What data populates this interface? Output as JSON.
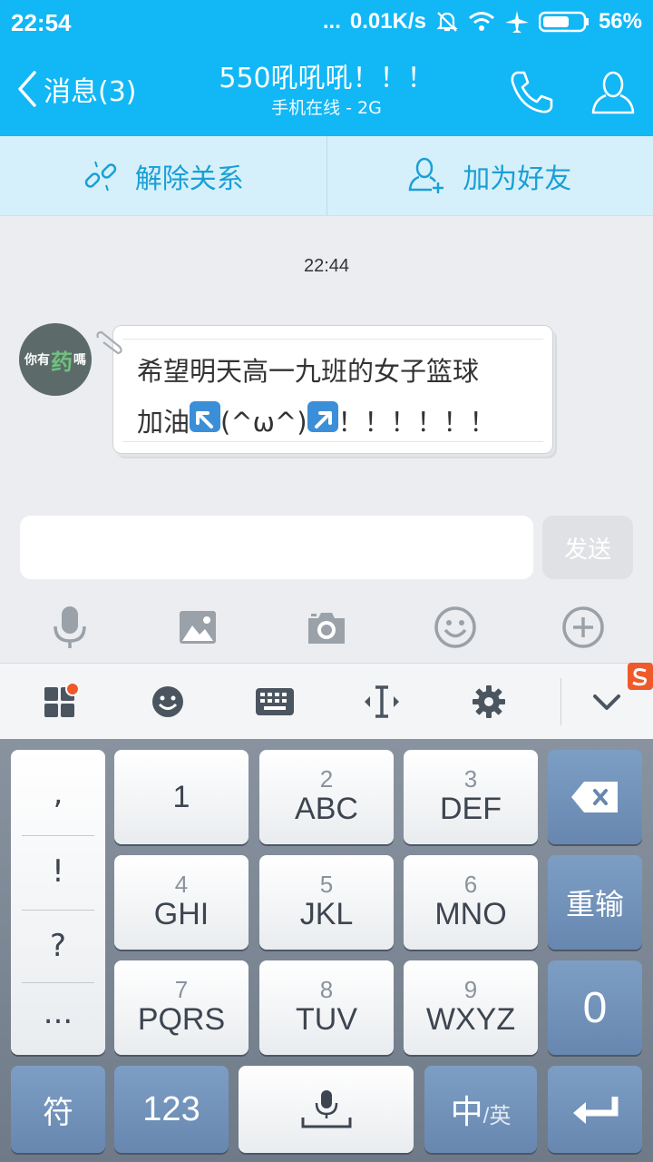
{
  "status_bar": {
    "time": "22:54",
    "dots": "...",
    "speed": "0.01K/s",
    "battery": "56%"
  },
  "header": {
    "back_label": "消息(3)",
    "title": "550吼吼吼！！！",
    "subtitle": "手机在线 - 2G"
  },
  "actions": {
    "unlink_label": "解除关系",
    "add_friend_label": "加为好友"
  },
  "chat": {
    "timestamp": "22:44",
    "avatar_text_1": "你有",
    "avatar_text_2": "药",
    "avatar_text_3": "嗎",
    "message_line1": "希望明天高一九班的女子篮球",
    "message_line2_a": "加油",
    "message_line2_b": "(^ω^)",
    "message_line2_c": "！！！！！！"
  },
  "composer": {
    "input_value": "",
    "send_label": "发送"
  },
  "keyboard": {
    "punct": [
      ",",
      "!",
      "?",
      "..."
    ],
    "row1": [
      {
        "num": "",
        "letters": "1"
      },
      {
        "num": "2",
        "letters": "ABC"
      },
      {
        "num": "3",
        "letters": "DEF"
      }
    ],
    "row2": [
      {
        "num": "4",
        "letters": "GHI"
      },
      {
        "num": "5",
        "letters": "JKL"
      },
      {
        "num": "6",
        "letters": "MNO"
      }
    ],
    "row3": [
      {
        "num": "7",
        "letters": "PQRS"
      },
      {
        "num": "8",
        "letters": "TUV"
      },
      {
        "num": "9",
        "letters": "WXYZ"
      }
    ],
    "reenter_label": "重输",
    "zero_label": "0",
    "symbol_label": "符",
    "numeric_label": "123",
    "lang_main": "中",
    "lang_sub": "/英"
  },
  "colors": {
    "brand": "#12b7f5",
    "action_bg": "#d5f0fa",
    "action_text": "#1a9fd6"
  }
}
